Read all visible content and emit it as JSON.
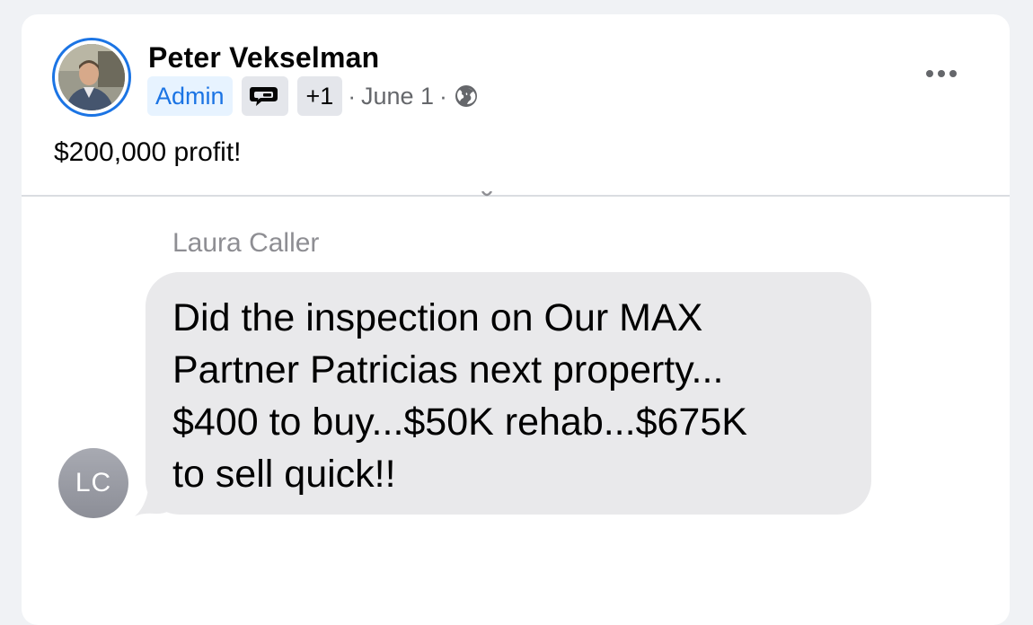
{
  "post": {
    "author": "Peter Vekselman",
    "badge_admin": "Admin",
    "badge_chat_icon": "chat-bubbles-icon",
    "badge_more": "+1",
    "separator": "·",
    "date": "June 1",
    "privacy_icon": "globe-icon",
    "more_icon": "more-horizontal-icon",
    "text": "$200,000 profit!"
  },
  "message": {
    "sender_name": "Laura Caller",
    "sender_initials": "LC",
    "body": "Did the inspection on Our MAX\nPartner Patricias next property...\n$400 to buy...$50K rehab...$675K\nto sell quick!!"
  },
  "colors": {
    "page_bg": "#f0f2f5",
    "card_bg": "#ffffff",
    "accent": "#1b74e4",
    "badge_admin_bg": "#e7f3ff",
    "badge_gray_bg": "#e4e6eb",
    "meta_text": "#65676b",
    "bubble_bg": "#e9e9eb",
    "sender_text": "#8e8e93"
  }
}
